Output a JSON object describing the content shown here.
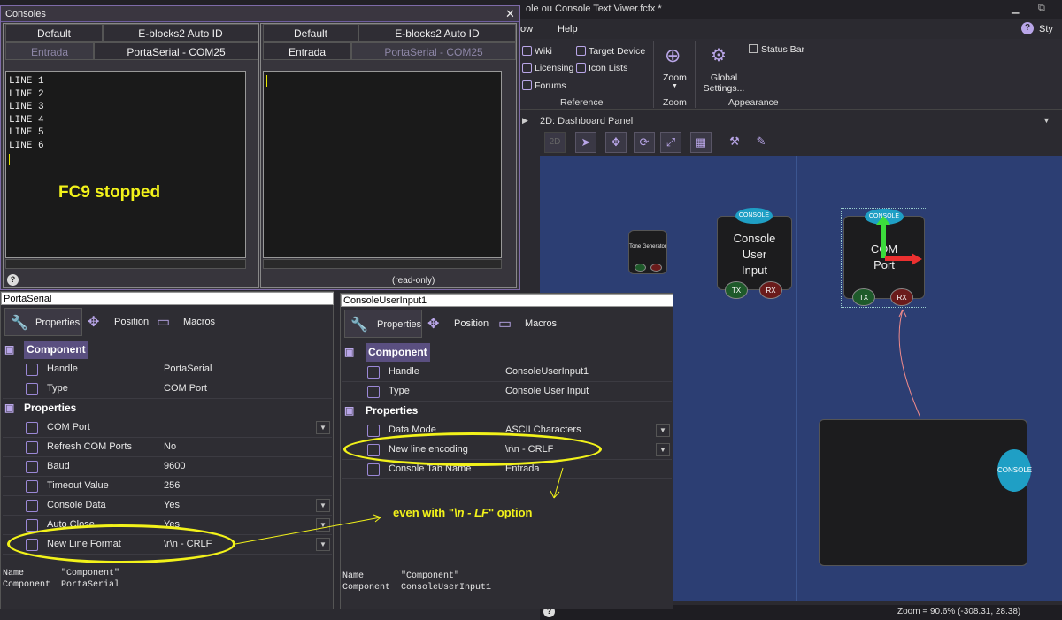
{
  "app": {
    "title": "ole ou Console Text Viwer.fcfx *",
    "menu": [
      "ow",
      "Help"
    ],
    "style_label": "Sty"
  },
  "ribbon": {
    "reference": {
      "wiki": "Wiki",
      "licensing": "Licensing",
      "forums": "Forums",
      "target_device": "Target Device",
      "icon_lists": "Icon Lists",
      "group": "Reference"
    },
    "zoom": {
      "label": "Zoom",
      "group": "Zoom"
    },
    "appearance": {
      "global_settings": "Global Settings...",
      "status_bar": "Status Bar",
      "group": "Appearance"
    }
  },
  "dashboard": {
    "title": "2D: Dashboard Panel",
    "tool_2d": "2D",
    "tone_generator": "Tone Generator",
    "console_user_input": "Console User Input",
    "com_port": "COM Port",
    "console_pill": "CONSOLE",
    "tx": "TX",
    "rx": "RX",
    "zoom_status": "Zoom = 90.6% (-308.31, 28.38)"
  },
  "consoles": {
    "title": "Consoles",
    "left": {
      "tabs": [
        "Default",
        "E-blocks2 Auto ID"
      ],
      "subtabs": [
        "Entrada",
        "PortaSerial - COM25"
      ],
      "lines": [
        "LINE 1",
        "LINE 2",
        "LINE 3",
        "LINE 4",
        "LINE 5",
        "LINE 6"
      ]
    },
    "right": {
      "tabs": [
        "Default",
        "E-blocks2 Auto ID"
      ],
      "subtabs": [
        "Entrada",
        "PortaSerial - COM25"
      ],
      "footer": "(read-only)"
    },
    "annotation": "FC9 stopped"
  },
  "left_props": {
    "selector": "PortaSerial",
    "tabs": {
      "properties": "Properties",
      "position": "Position",
      "macros": "Macros"
    },
    "component_header": "Component",
    "properties_header": "Properties",
    "rows_component": [
      {
        "name": "Handle",
        "value": "PortaSerial"
      },
      {
        "name": "Type",
        "value": "COM Port"
      }
    ],
    "rows_properties": [
      {
        "name": "COM Port",
        "value": ""
      },
      {
        "name": "Refresh COM Ports",
        "value": "No"
      },
      {
        "name": "Baud",
        "value": "9600"
      },
      {
        "name": "Timeout Value",
        "value": "256"
      },
      {
        "name": "Console Data",
        "value": "Yes"
      },
      {
        "name": "Auto Close",
        "value": "Yes"
      },
      {
        "name": "New Line Format",
        "value": "\\r\\n - CRLF"
      }
    ],
    "desc": [
      "Name       \"Component\"",
      "Component  PortaSerial"
    ]
  },
  "right_props": {
    "selector": "ConsoleUserInput1",
    "tabs": {
      "properties": "Properties",
      "position": "Position",
      "macros": "Macros"
    },
    "component_header": "Component",
    "properties_header": "Properties",
    "rows_component": [
      {
        "name": "Handle",
        "value": "ConsoleUserInput1"
      },
      {
        "name": "Type",
        "value": "Console User Input"
      }
    ],
    "rows_properties": [
      {
        "name": "Data Mode",
        "value": "ASCII Characters"
      },
      {
        "name": "New line encoding",
        "value": "\\r\\n - CRLF"
      },
      {
        "name": "Console Tab Name",
        "value": "Entrada"
      }
    ],
    "desc": [
      "Name       \"Component\"",
      "Component  ConsoleUserInput1"
    ]
  },
  "annotations": {
    "even_with_prefix": "even with \"",
    "even_with_em": "\\n - LF",
    "even_with_suffix": "\" option"
  },
  "colors": {
    "accent": "#7e6ba8",
    "highlight": "#f2f21a",
    "canvas": "#2c3e73",
    "console_pill": "#1f9fc5"
  }
}
